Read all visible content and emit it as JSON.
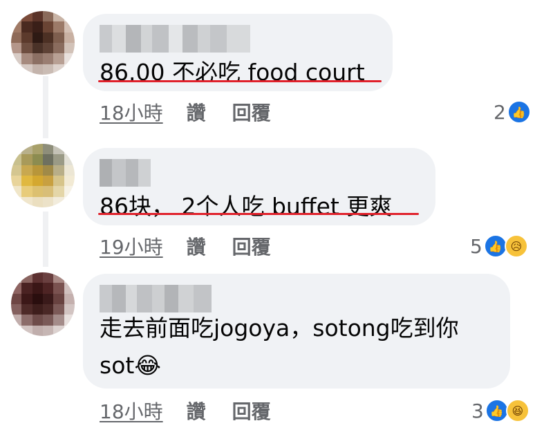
{
  "comments": [
    {
      "text": "86.00 不必吃 food court",
      "time": "18小時",
      "like_label": "讚",
      "reply_label": "回覆",
      "reaction_count": "2",
      "reactions": [
        "like-icon"
      ]
    },
    {
      "text": "86块， 2个人吃 buffet 更爽",
      "time": "19小時",
      "like_label": "讚",
      "reply_label": "回覆",
      "reaction_count": "5",
      "reactions": [
        "like-icon",
        "sad-icon"
      ]
    },
    {
      "text_line1": "走去前面吃jogoya，sotong吃到你",
      "text_line2": "sot😂",
      "time": "18小時",
      "like_label": "讚",
      "reply_label": "回覆",
      "reaction_count": "3",
      "reactions": [
        "like-icon",
        "haha-icon"
      ]
    }
  ],
  "colors": {
    "bubble": "#f0f2f5",
    "underline": "#e0202a",
    "like": "#1b74e4",
    "meta_text": "#65676b"
  }
}
